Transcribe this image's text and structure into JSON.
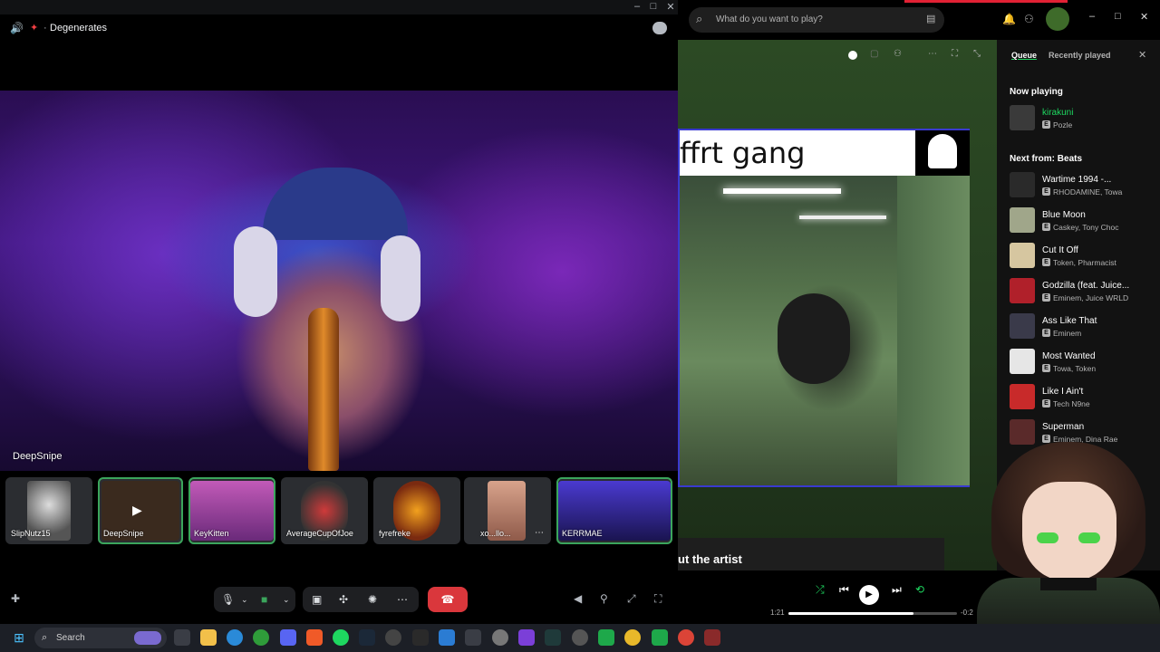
{
  "call": {
    "channel": "Degenerates",
    "main_speaker": "DeepSnipe",
    "participants": [
      {
        "name": "SlipNutz15"
      },
      {
        "name": "DeepSnipe"
      },
      {
        "name": "KeyKitten"
      },
      {
        "name": "AverageCupOfJoe"
      },
      {
        "name": "fyrefreke"
      },
      {
        "name": "xo...llo..."
      },
      {
        "name": "KERRMAE"
      }
    ]
  },
  "spotify": {
    "search_placeholder": "What do you want to play?",
    "canvas_title": "ffrt gang",
    "about_label": "ut the artist",
    "queue": {
      "tab_queue": "Queue",
      "tab_recent": "Recently played",
      "now_playing_label": "Now playing",
      "now_playing": {
        "title": "kirakuni",
        "artist": "Pozle",
        "badge": "E"
      },
      "next_label": "Next from: Beats",
      "next": [
        {
          "title": "Wartime 1994 -...",
          "artist": "RHODAMINE, Towa"
        },
        {
          "title": "Blue Moon",
          "artist": "Caskey, Tony Choc"
        },
        {
          "title": "Cut It Off",
          "artist": "Token, Pharmacist"
        },
        {
          "title": "Godzilla (feat. Juice...",
          "artist": "Eminem, Juice WRLD"
        },
        {
          "title": "Ass Like That",
          "artist": "Eminem"
        },
        {
          "title": "Most Wanted",
          "artist": "Towa, Token"
        },
        {
          "title": "Like I Ain't",
          "artist": "Tech N9ne"
        },
        {
          "title": "Superman",
          "artist": "Eminem, Dina Rae"
        }
      ]
    },
    "player": {
      "elapsed": "1:21",
      "remaining": "-0:2",
      "progress": 0.74
    }
  },
  "taskbar": {
    "search_label": "Search"
  },
  "colors": {
    "spotify_green": "#1ed760",
    "discord_red": "#da373c",
    "discord_green": "#3ba55c"
  }
}
